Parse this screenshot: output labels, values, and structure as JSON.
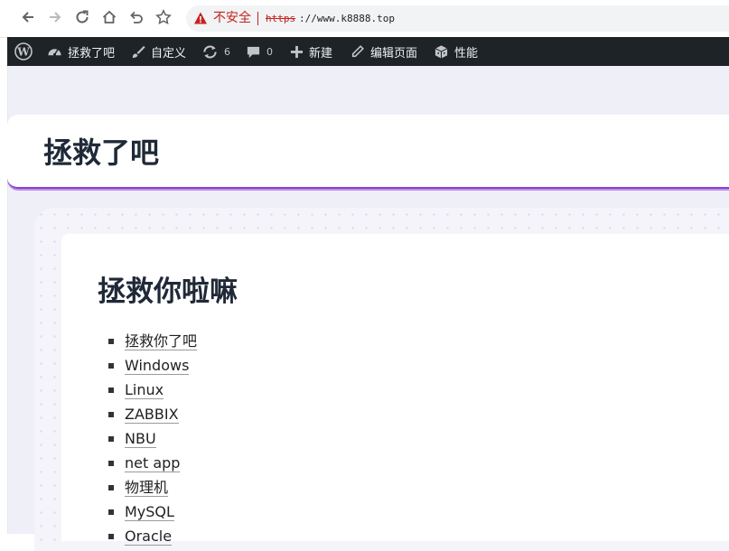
{
  "browser": {
    "security_label": "不安全",
    "url_scheme": "https",
    "url_rest": "://www.k8888.top"
  },
  "admin_bar": {
    "site_name": "拯救了吧",
    "customize": "自定义",
    "updates_count": "6",
    "comments_count": "0",
    "new": "新建",
    "edit_page": "编辑页面",
    "performance": "性能"
  },
  "site": {
    "title": "拯救了吧",
    "accent_color": "#8a3fd1"
  },
  "content": {
    "heading": "拯救你啦嘛",
    "links": [
      "拯救你了吧",
      "Windows",
      "Linux",
      "ZABBIX",
      "NBU",
      "net app",
      "物理机",
      "MySQL",
      "Oracle"
    ]
  }
}
